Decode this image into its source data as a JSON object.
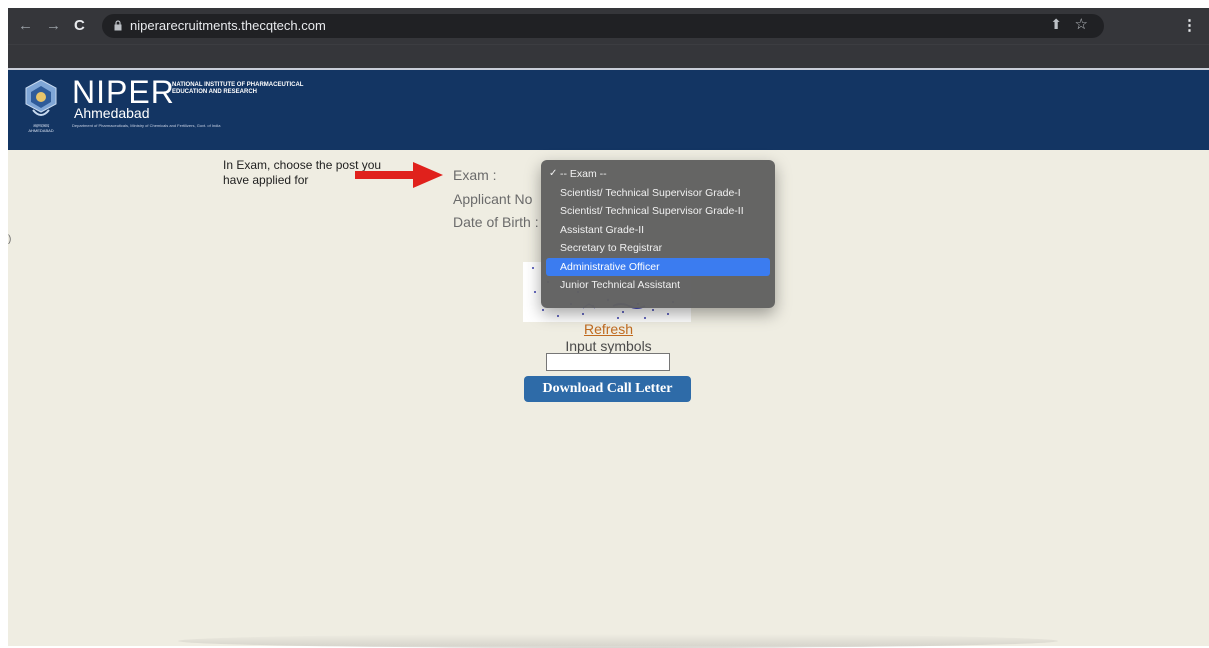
{
  "browser": {
    "url": "niperarecruitments.thecqtech.com",
    "back_glyph": "←",
    "forward_glyph": "→",
    "reload_glyph": "C",
    "share_glyph": "⬆",
    "star_glyph": "☆",
    "menu_glyph": "⋮"
  },
  "header": {
    "brand": "NIPER",
    "city": "Ahmedabad",
    "institute": "National Institute of Pharmaceutical Education and Research",
    "department": "Department of Pharmaceuticals, Ministry of Chemicals and Fertilizers, Govt. of India",
    "emblem_caption": "अहमदाबाद AHMEDABAD",
    "background_color": "#133563"
  },
  "annotation": {
    "text": "In Exam, choose the post you have applied for",
    "arrow_color": "#e0211c"
  },
  "form": {
    "exam_label": "Exam :",
    "applicant_label": "Applicant No",
    "dob_label": "Date of Birth :",
    "refresh_label": "Refresh",
    "input_symbols_label": "Input symbols",
    "captcha_value": "",
    "download_label": "Download Call Letter"
  },
  "exam_dropdown": {
    "options": [
      "-- Exam --",
      "Scientist/ Technical Supervisor Grade-I",
      "Scientist/ Technical Supervisor Grade-II",
      "Assistant Grade-II",
      "Secretary to Registrar",
      "Administrative Officer",
      "Junior Technical Assistant"
    ],
    "checked_option": "-- Exam --",
    "highlighted_option": "Administrative Officer",
    "check_glyph": "✓"
  },
  "left_edge_mark": ")",
  "colors": {
    "page_background": "#efede2",
    "download_button": "#2e6ba8",
    "refresh_link": "#c06a1f",
    "dropdown_highlight": "#3b7cf0"
  }
}
